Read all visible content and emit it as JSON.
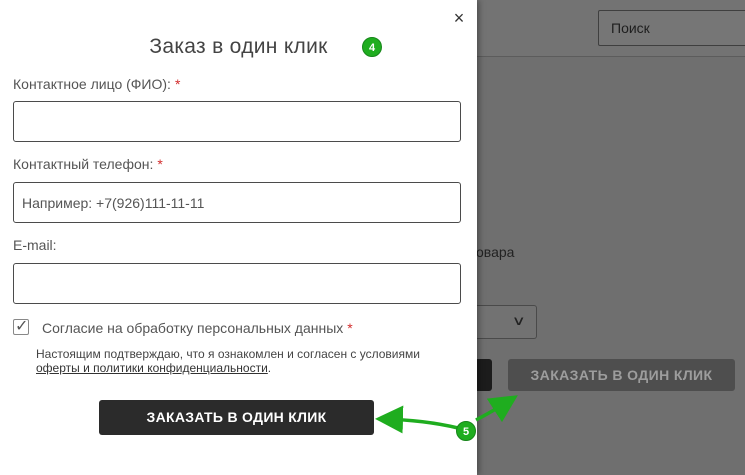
{
  "background": {
    "search_placeholder": "Поиск",
    "partial_text": "овара",
    "order_button_label": "ЗАКАЗАТЬ В ОДИН КЛИК"
  },
  "modal": {
    "title": "Заказ в один клик",
    "close_label": "×",
    "fields": {
      "name": {
        "label": "Контактное лицо (ФИО):",
        "required_mark": "*",
        "value": ""
      },
      "phone": {
        "label": "Контактный телефон:",
        "required_mark": "*",
        "placeholder": "Например: +7(926)111-11-11"
      },
      "email": {
        "label": "E-mail:",
        "value": ""
      }
    },
    "consent": {
      "checked": true,
      "label": "Согласие на обработку персональных данных",
      "required_mark": "*",
      "note_prefix": "Настоящим подтверждаю, что я ознакомлен и согласен с условиями",
      "note_link": "оферты и политики конфиденциальности",
      "note_suffix": "."
    },
    "submit_label": "ЗАКАЗАТЬ В ОДИН КЛИК"
  },
  "annotations": {
    "badge_title": "4",
    "badge_arrows": "5",
    "color": "#1fad1f"
  }
}
